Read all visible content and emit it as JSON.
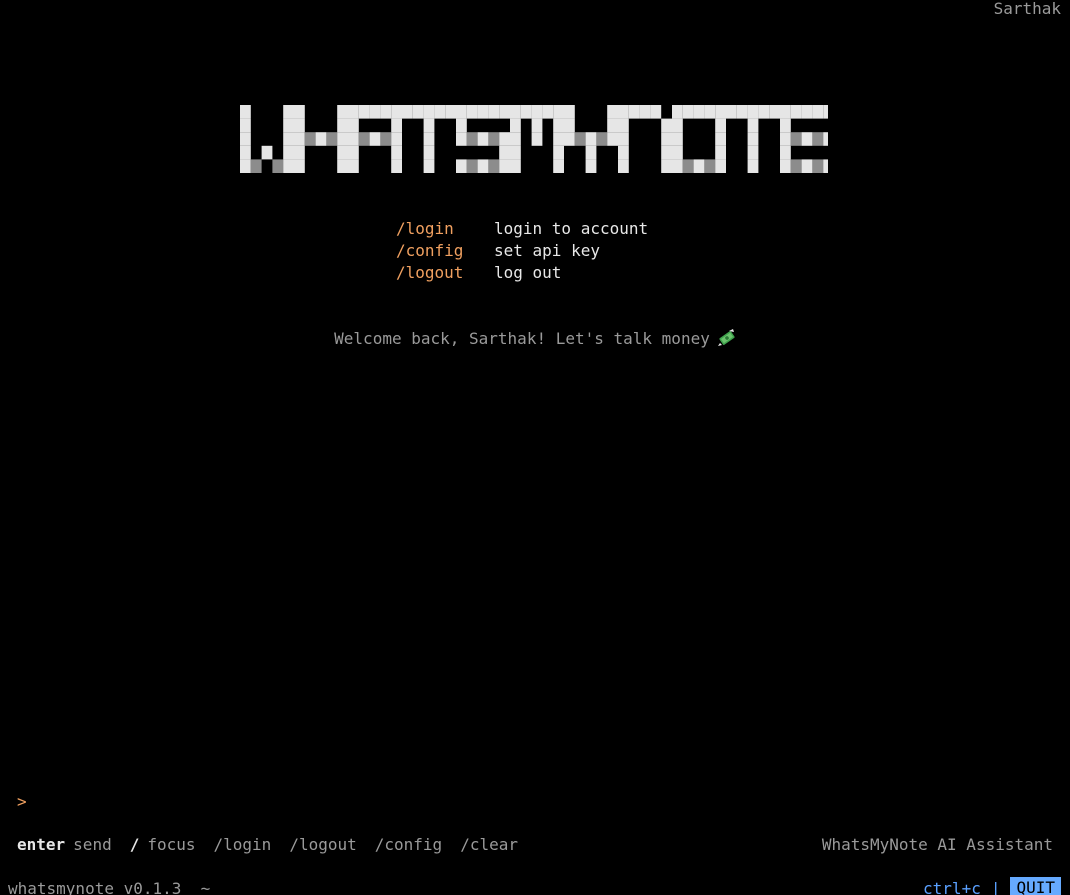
{
  "header": {
    "username": "Sarthak"
  },
  "logo": {
    "text": "WHATSMYNOTE",
    "colors": {
      "light": "#e6e6e6",
      "dark": "#8c8c8c"
    }
  },
  "commands": [
    {
      "name": "/login",
      "description": "login to account"
    },
    {
      "name": "/config",
      "description": "set api key"
    },
    {
      "name": "/logout",
      "description": "log out"
    }
  ],
  "welcome": {
    "message": "Welcome back, Sarthak! Let's talk money",
    "icon": "money-with-wings-icon"
  },
  "input": {
    "prompt_symbol": ">",
    "value": ""
  },
  "helpbar": {
    "enter_key": "enter",
    "enter_desc": "send",
    "focus_key": "/",
    "focus_desc": "focus",
    "links": [
      "/login",
      "/logout",
      "/config",
      "/clear"
    ]
  },
  "assistant_label": "WhatsMyNote AI Assistant",
  "footer": {
    "version": "whatsmynote v0.1.3  ~",
    "quit_hint": "ctrl+c",
    "separator": "|",
    "quit_label": "QUIT"
  },
  "colors": {
    "background": "#000000",
    "accent": "#f0a060",
    "muted": "#9a9a9a",
    "quit": "#66aaff"
  }
}
